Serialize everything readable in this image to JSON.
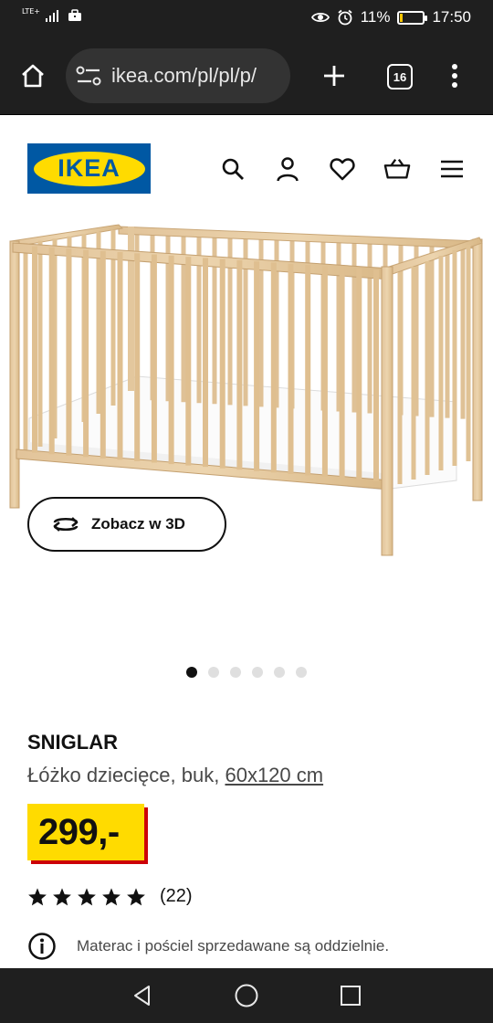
{
  "status_bar": {
    "network_label": "LTE+",
    "battery_percent": "11%",
    "battery_level": 0.11,
    "time": "17:50"
  },
  "browser": {
    "url": "ikea.com/pl/pl/p/",
    "tab_count": "16"
  },
  "header": {
    "logo_text": "IKEA",
    "brand_blue": "#0058a3",
    "brand_yellow": "#ffdb00",
    "icons": [
      "search-icon",
      "account-icon",
      "heart-icon",
      "basket-icon",
      "menu-icon"
    ]
  },
  "gallery": {
    "view_3d_label": "Zobacz w 3D",
    "total_images": 6,
    "active_index": 0
  },
  "product": {
    "name": "SNIGLAR",
    "description": "Łóżko dziecięce, buk,",
    "size_link": "60x120 cm",
    "price": "299,-",
    "rating_stars": 5,
    "review_count": "(22)",
    "info_note": "Materac i pościel sprzedawane są oddzielnie."
  }
}
